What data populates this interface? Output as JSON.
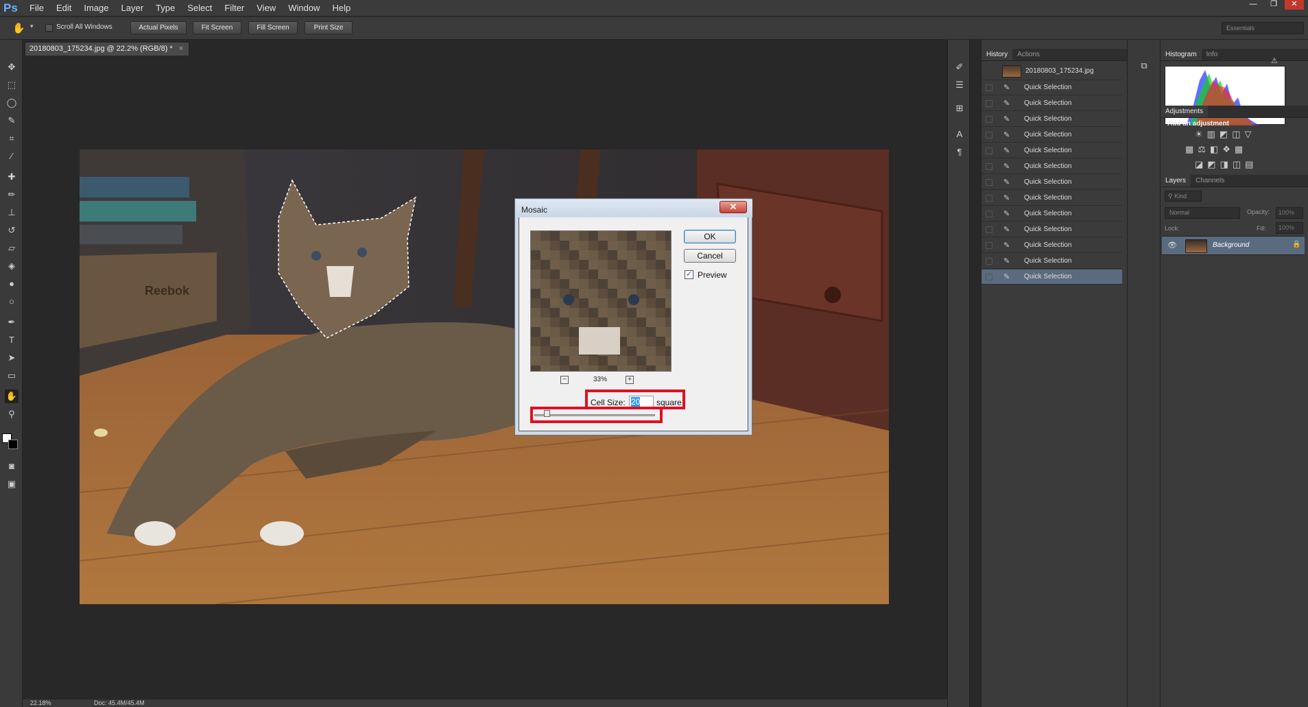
{
  "app": {
    "logo": "Ps",
    "window_controls": [
      "—",
      "❐",
      "✕"
    ]
  },
  "menu": [
    "File",
    "Edit",
    "Image",
    "Layer",
    "Type",
    "Select",
    "Filter",
    "View",
    "Window",
    "Help"
  ],
  "options": {
    "scroll_all": "Scroll All Windows",
    "buttons": [
      "Actual Pixels",
      "Fit Screen",
      "Fill Screen",
      "Print Size"
    ],
    "workspace": "Essentials"
  },
  "document": {
    "tab": "20180803_175234.jpg @ 22.2% (RGB/8) *",
    "zoom": "22.18%",
    "doc_size": "Doc: 45.4M/45.4M"
  },
  "history": {
    "tabs": [
      "History",
      "Actions"
    ],
    "snapshot": "20180803_175234.jpg",
    "states": [
      "Quick Selection",
      "Quick Selection",
      "Quick Selection",
      "Quick Selection",
      "Quick Selection",
      "Quick Selection",
      "Quick Selection",
      "Quick Selection",
      "Quick Selection",
      "Quick Selection",
      "Quick Selection",
      "Quick Selection",
      "Quick Selection"
    ]
  },
  "right": {
    "histogram_tabs": [
      "Histogram",
      "Info"
    ],
    "adjustments_tab": "Adjustments",
    "add_adjustment": "Add an adjustment",
    "layers_tabs": [
      "Layers",
      "Channels"
    ],
    "kind": "Kind",
    "blend": "Normal",
    "opacity_label": "Opacity:",
    "opacity": "100%",
    "lock_label": "Lock:",
    "fill_label": "Fill:",
    "fill": "100%",
    "layer_name": "Background"
  },
  "dialog": {
    "title": "Mosaic",
    "ok": "OK",
    "cancel": "Cancel",
    "preview": "Preview",
    "zoom": "33%",
    "cell_size_label": "Cell Size:",
    "cell_size": "20",
    "unit": "square",
    "slider_fraction": 0.1
  },
  "colors": {
    "accent": "#6ab2ff",
    "highlight": "#e01020",
    "selection": "#5a6b80"
  }
}
